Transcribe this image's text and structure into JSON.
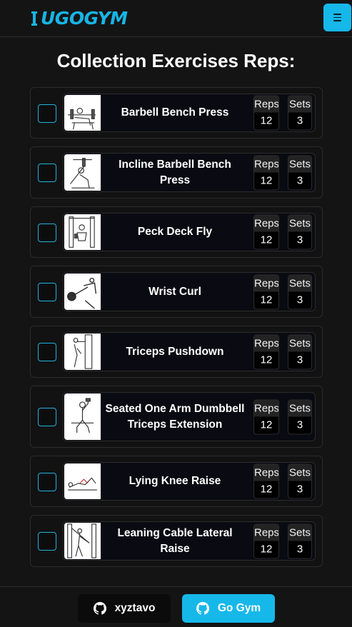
{
  "brand": {
    "logo_text": "UGOGYM",
    "color": "#16b8ea"
  },
  "page": {
    "title": "Collection Exercises Reps:"
  },
  "labels": {
    "reps": "Reps",
    "sets": "Sets"
  },
  "exercises": [
    {
      "name": "Barbell Bench Press",
      "reps": "12",
      "sets": "3",
      "checked": false
    },
    {
      "name": "Incline Barbell Bench Press",
      "reps": "12",
      "sets": "3",
      "checked": false
    },
    {
      "name": "Peck Deck Fly",
      "reps": "12",
      "sets": "3",
      "checked": false
    },
    {
      "name": "Wrist Curl",
      "reps": "12",
      "sets": "3",
      "checked": false
    },
    {
      "name": "Triceps Pushdown",
      "reps": "12",
      "sets": "3",
      "checked": false
    },
    {
      "name": "Seated One Arm Dumbbell Triceps Extension",
      "reps": "12",
      "sets": "3",
      "checked": false
    },
    {
      "name": "Lying Knee Raise",
      "reps": "12",
      "sets": "3",
      "checked": false
    },
    {
      "name": "Leaning Cable Lateral Raise",
      "reps": "12",
      "sets": "3",
      "checked": false
    }
  ],
  "footer": {
    "github_label": "xyztavo",
    "gogym_label": "Go Gym"
  },
  "icons": {
    "menu": "hamburger-icon",
    "github": "github-icon"
  }
}
